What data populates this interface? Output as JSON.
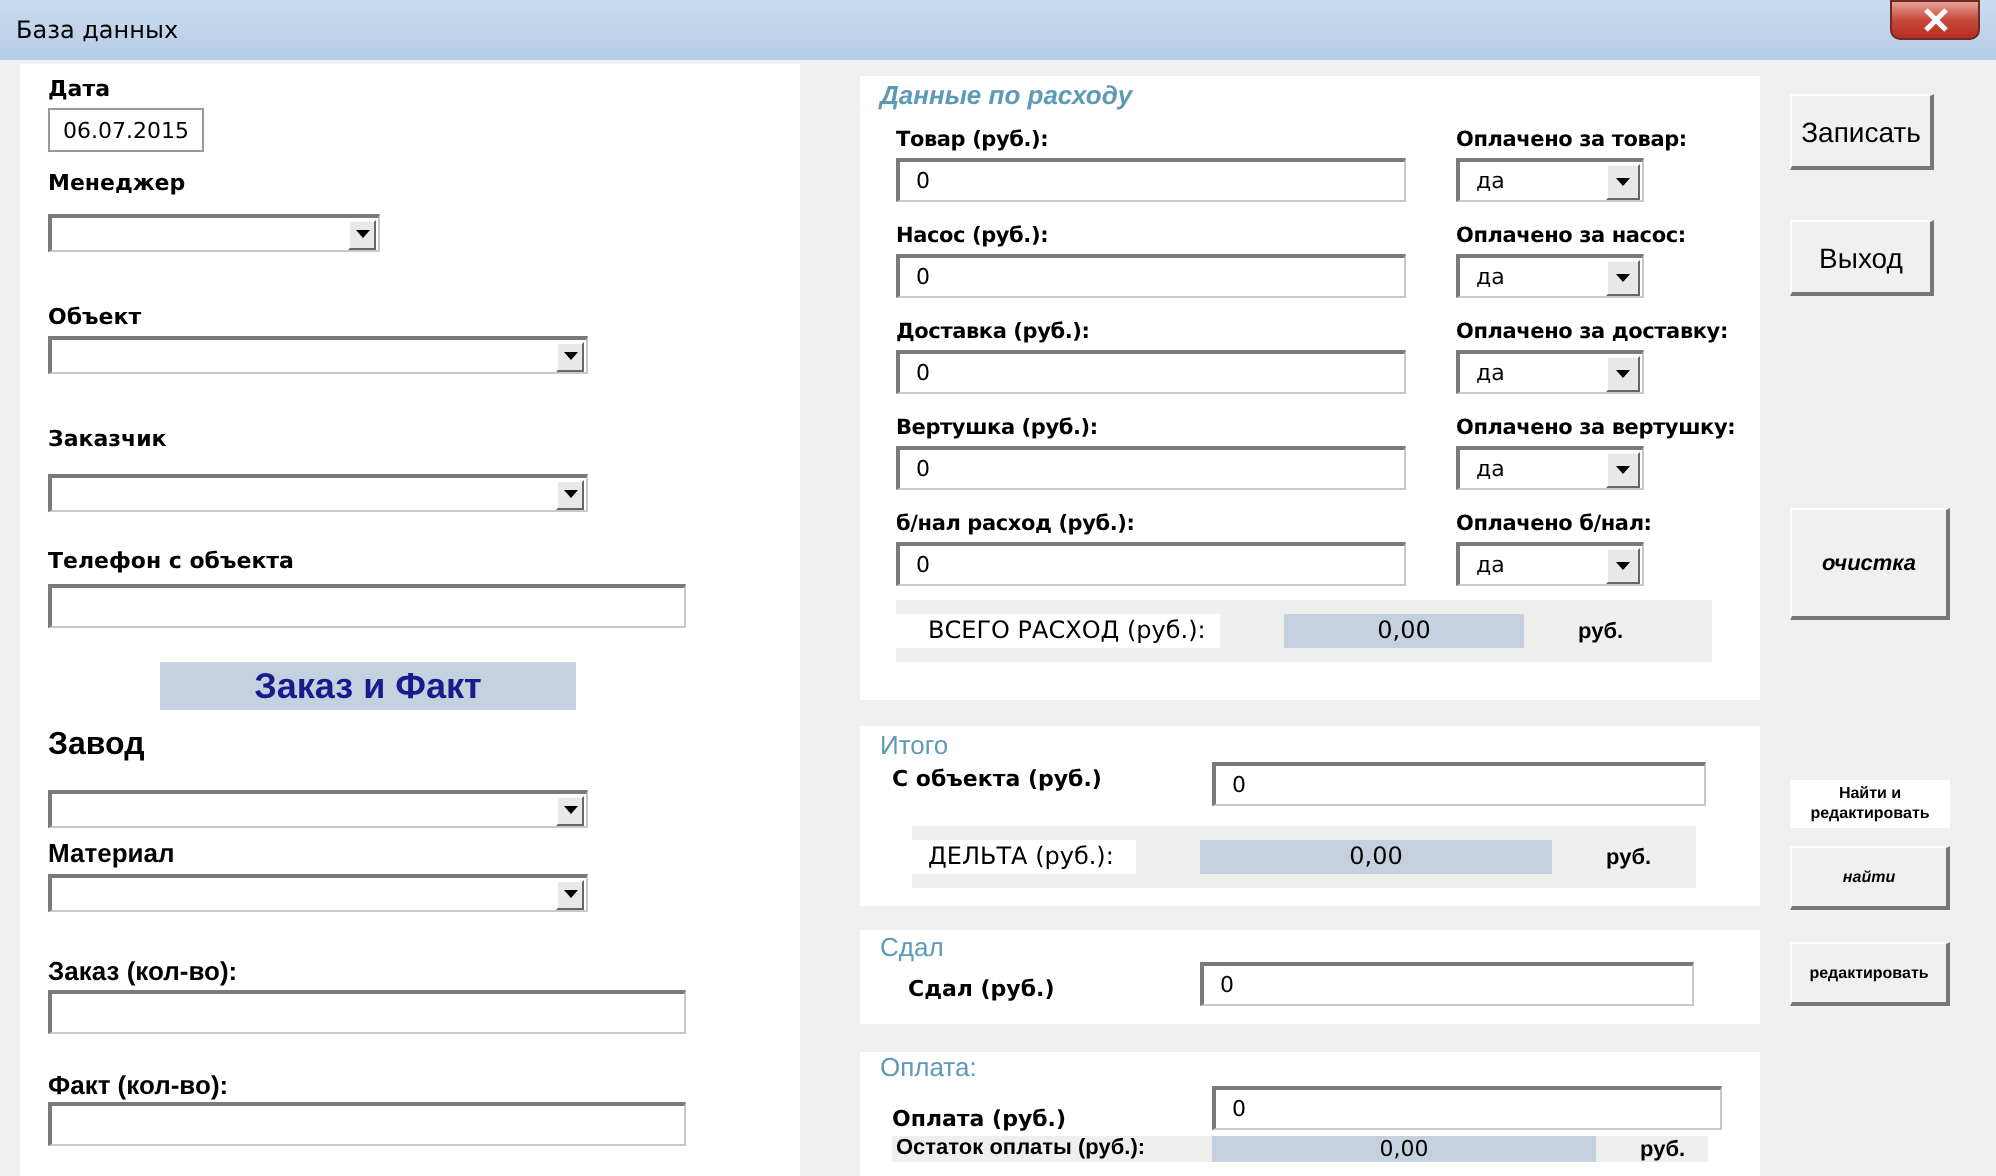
{
  "window": {
    "title": "База данных"
  },
  "left": [
    {
      "kind": "date",
      "label": "Дата",
      "value": "06.07.2015"
    },
    {
      "kind": "combo",
      "label": "Менеджер"
    },
    {
      "kind": "combo",
      "label": "Объект"
    },
    {
      "kind": "combo",
      "label": "Заказчик"
    },
    {
      "kind": "text",
      "label": "Телефон с объекта"
    },
    {
      "kind": "banner",
      "label": "Заказ и Факт"
    },
    {
      "kind": "section-combo",
      "label": "Завод"
    },
    {
      "kind": "combo",
      "label": "Материал"
    },
    {
      "kind": "text",
      "label": "Заказ (кол-во):"
    },
    {
      "kind": "text",
      "label": "Факт (кол-во):"
    }
  ],
  "expenses": {
    "title": "Данные по расходу",
    "rows": [
      {
        "label": "Товар (руб.):",
        "value": "0",
        "paid_label": "Оплачено за товар:",
        "paid_value": "да"
      },
      {
        "label": "Насос (руб.):",
        "value": "0",
        "paid_label": "Оплачено за насос:",
        "paid_value": "да"
      },
      {
        "label": "Доставка (руб.):",
        "value": "0",
        "paid_label": "Оплачено за доставку:",
        "paid_value": "да"
      },
      {
        "label": "Вертушка (руб.):",
        "value": "0",
        "paid_label": "Оплачено за вертушку:",
        "paid_value": "да"
      },
      {
        "label": "б/нал расход (руб.):",
        "value": "0",
        "paid_label": "Оплачено б/нал:",
        "paid_value": "да"
      }
    ],
    "total": {
      "label": "ВСЕГО РАСХОД (руб.):",
      "value": "0,00",
      "unit": "руб."
    }
  },
  "summary": {
    "title": "Итого",
    "field": {
      "label": "С объекта (руб.)",
      "value": "0"
    },
    "delta": {
      "label": "ДЕЛЬТА (руб.):",
      "value": "0,00",
      "unit": "руб."
    }
  },
  "handed": {
    "title": "Сдал",
    "field": {
      "label": "Сдал (руб.)",
      "value": "0"
    }
  },
  "payment": {
    "title": "Оплата:",
    "field": {
      "label": "Оплата (руб.)",
      "value": "0"
    },
    "remainder": {
      "label": "Остаток оплаты (руб.):",
      "value": "0,00",
      "unit": "руб."
    }
  },
  "buttons": [
    {
      "kind": "large",
      "label": "Записать"
    },
    {
      "kind": "large",
      "label": "Выход"
    },
    {
      "kind": "italic",
      "label": "очистка"
    },
    {
      "kind": "caption",
      "label": "Найти и редактировать"
    },
    {
      "kind": "small-italic",
      "label": "найти"
    },
    {
      "kind": "small",
      "label": "редактировать"
    }
  ]
}
